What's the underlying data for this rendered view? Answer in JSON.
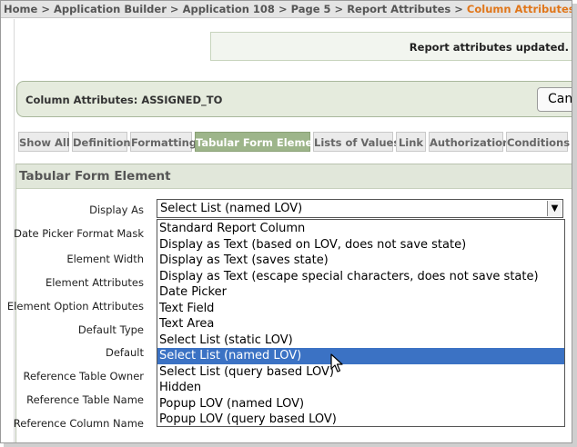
{
  "breadcrumb": {
    "items": [
      "Home",
      "Application Builder",
      "Application 108",
      "Page 5",
      "Report Attributes"
    ],
    "separator": ">",
    "current": "Column Attributes"
  },
  "message": {
    "text": "Report attributes updated."
  },
  "region_header": {
    "title": "Column Attributes: ASSIGNED_TO",
    "cancel_label": "Can"
  },
  "tabs": [
    {
      "label": "Show All",
      "active": false
    },
    {
      "label": "Definition",
      "active": false
    },
    {
      "label": "Formatting",
      "active": false
    },
    {
      "label": "Tabular Form Element",
      "active": true
    },
    {
      "label": "Lists of Values",
      "active": false
    },
    {
      "label": "Link",
      "active": false
    },
    {
      "label": "Authorization",
      "active": false
    },
    {
      "label": "Conditions",
      "active": false
    }
  ],
  "region": {
    "title": "Tabular Form Element",
    "labels": {
      "display_as": "Display As",
      "date_picker_format_mask": "Date Picker Format Mask",
      "element_width": "Element Width",
      "element_attributes": "Element Attributes",
      "element_option_attributes": "Element Option Attributes",
      "default_type": "Default Type",
      "default": "Default",
      "reference_table_owner": "Reference Table Owner",
      "reference_table_name": "Reference Table Name",
      "reference_column_name": "Reference Column Name"
    }
  },
  "display_as": {
    "value": "Select List (named LOV)",
    "options": [
      "Standard Report Column",
      "Display as Text (based on LOV, does not save state)",
      "Display as Text (saves state)",
      "Display as Text (escape special characters, does not save state)",
      "Date Picker",
      "Text Field",
      "Text Area",
      "Select List (static LOV)",
      "Select List (named LOV)",
      "Select List (query based LOV)",
      "Hidden",
      "Popup LOV (named LOV)",
      "Popup LOV (query based LOV)"
    ],
    "highlighted_index": 8
  },
  "colors": {
    "breadcrumb_current": "#e0761a",
    "active_tab": "#9db58a",
    "selection": "#3b72c4",
    "region_header_bg": "#e1e7da"
  },
  "icons": {
    "dropdown_arrow": "chevron-down-icon",
    "cursor": "mouse-pointer-icon"
  }
}
